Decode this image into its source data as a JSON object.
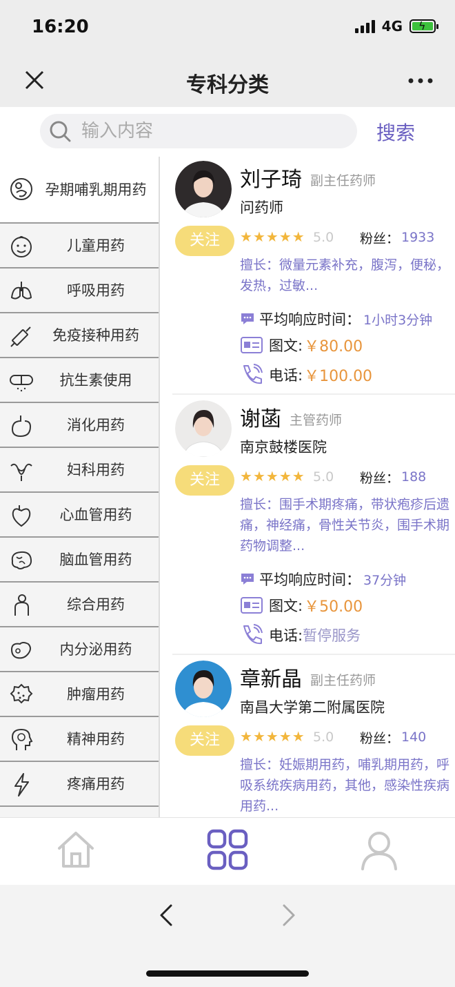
{
  "status": {
    "time": "16:20",
    "network": "4G"
  },
  "nav": {
    "title": "专科分类"
  },
  "search": {
    "placeholder": "输入内容",
    "button": "搜索"
  },
  "categories": [
    {
      "label": "孕期哺乳期用药",
      "icon": "pregnancy-icon"
    },
    {
      "label": "儿童用药",
      "icon": "child-face-icon"
    },
    {
      "label": "呼吸用药",
      "icon": "lungs-icon"
    },
    {
      "label": "免疫接种用药",
      "icon": "syringe-icon"
    },
    {
      "label": "抗生素使用",
      "icon": "capsule-icon"
    },
    {
      "label": "消化用药",
      "icon": "stomach-icon"
    },
    {
      "label": "妇科用药",
      "icon": "uterus-icon"
    },
    {
      "label": "心血管用药",
      "icon": "heart-icon"
    },
    {
      "label": "脑血管用药",
      "icon": "brain-icon"
    },
    {
      "label": "综合用药",
      "icon": "person-icon"
    },
    {
      "label": "内分泌用药",
      "icon": "gland-icon"
    },
    {
      "label": "肿瘤用药",
      "icon": "tumor-cell-icon"
    },
    {
      "label": "精神用药",
      "icon": "head-brain-icon"
    },
    {
      "label": "疼痛用药",
      "icon": "lightning-icon"
    }
  ],
  "doctors": [
    {
      "name": "刘子琦",
      "title": "副主任药师",
      "org": "问药师",
      "follow": "关注",
      "rating": "5.0",
      "fans_label": "粉丝：",
      "fans": "1933",
      "specialty": "擅长：微量元素补充，腹泻，便秘，发热，过敏...",
      "response_label": "平均响应时间：",
      "response_time": "1小时3分钟",
      "text_label": "图文:",
      "text_price": "￥80.00",
      "phone_label": "电话:",
      "phone_price": "￥100.00"
    },
    {
      "name": "谢菡",
      "title": "主管药师",
      "org": "南京鼓楼医院",
      "follow": "关注",
      "rating": "5.0",
      "fans_label": "粉丝：",
      "fans": "188",
      "specialty": "擅长：围手术期疼痛，带状疱疹后遗痛，神经痛，骨性关节炎，围手术期药物调整...",
      "response_label": "平均响应时间：",
      "response_time": "37分钟",
      "text_label": "图文:",
      "text_price": "￥50.00",
      "phone_label": "电话:",
      "phone_status": "暂停服务"
    },
    {
      "name": "章新晶",
      "title": "副主任药师",
      "org": "南昌大学第二附属医院",
      "follow": "关注",
      "rating": "5.0",
      "fans_label": "粉丝：",
      "fans": "140",
      "specialty": "擅长：妊娠期用药，哺乳期用药，呼吸系统疾病用药，其他，感染性疾病用药..."
    }
  ],
  "tabs": [
    {
      "icon": "home-icon",
      "active": false
    },
    {
      "icon": "grid-icon",
      "active": true
    },
    {
      "icon": "profile-icon",
      "active": false
    }
  ],
  "colors": {
    "accent": "#6a5fc1",
    "follow": "#f6dc7a",
    "star": "#f2b63c",
    "price": "#e8953c"
  }
}
